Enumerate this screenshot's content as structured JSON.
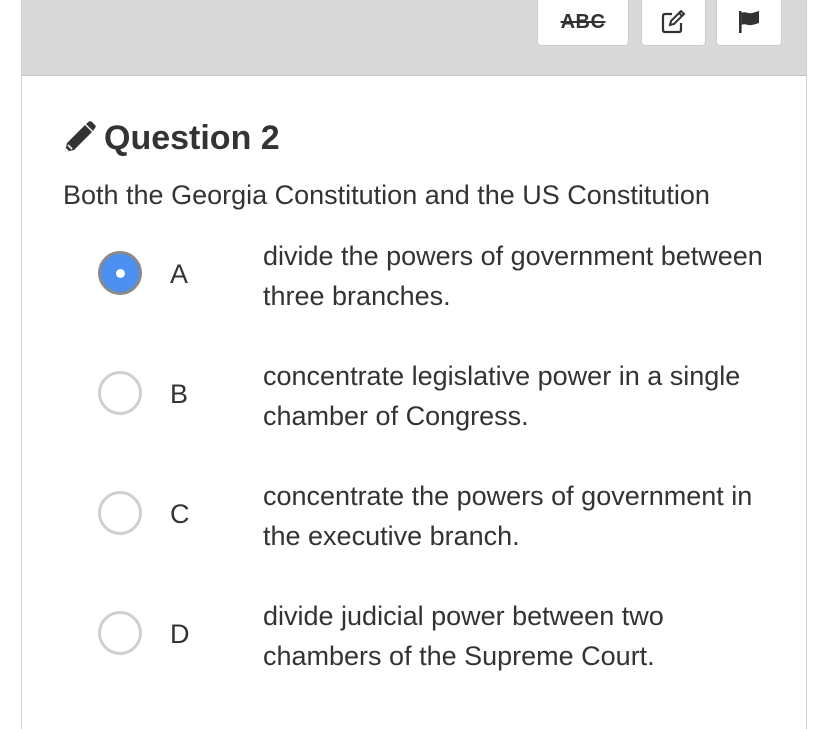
{
  "toolbar": {
    "strikethrough_label": "ABC",
    "notes_icon": "edit-note-icon",
    "flag_icon": "flag-icon"
  },
  "question": {
    "icon": "pencil-icon",
    "title": "Question 2",
    "prompt": "Both the Georgia Constitution and the US Constitution"
  },
  "options": [
    {
      "letter": "A",
      "text": "divide the powers of government between three branches.",
      "selected": true
    },
    {
      "letter": "B",
      "text": "concentrate legislative power in a single chamber of Congress.",
      "selected": false
    },
    {
      "letter": "C",
      "text": "concentrate the powers of government in the executive branch.",
      "selected": false
    },
    {
      "letter": "D",
      "text": "divide judicial power between two chambers of the Supreme Court.",
      "selected": false
    }
  ],
  "colors": {
    "selected_radio": "#4b8ff0",
    "toolbar_bg": "#d9d9d9",
    "text": "#333333"
  }
}
